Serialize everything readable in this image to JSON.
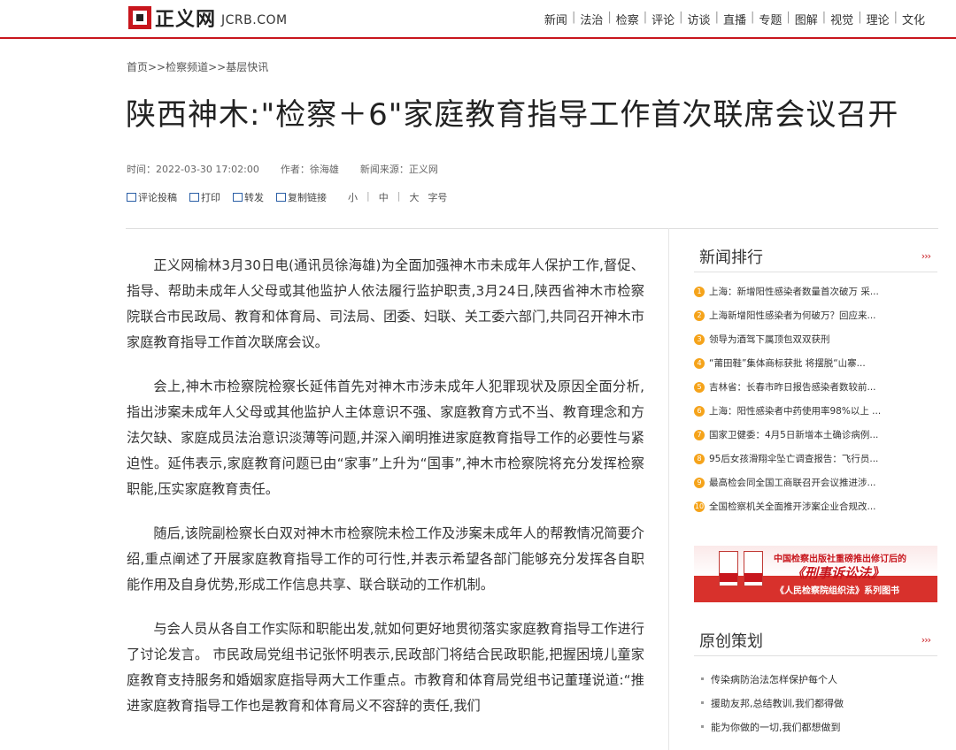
{
  "header": {
    "logo_cn": "正义网",
    "logo_en": "JCRB.COM",
    "nav": [
      "新闻",
      "法治",
      "检察",
      "评论",
      "访谈",
      "直播",
      "专题",
      "图解",
      "视觉",
      "理论",
      "文化"
    ]
  },
  "breadcrumb": "首页>>检察频道>>基层快讯",
  "article": {
    "title": "陕西神木:\"检察＋6\"家庭教育指导工作首次联席会议召开",
    "time": "时间：2022-03-30 17:02:00",
    "author": "作者：徐海雄",
    "source": "新闻来源：正义网",
    "tools": [
      "评论投稿",
      "打印",
      "转发",
      "复制链接"
    ],
    "font_sizes": [
      "小",
      "中",
      "大",
      "字号"
    ],
    "paragraphs": [
      "正义网榆林3月30日电(通讯员徐海雄)为全面加强神木市未成年人保护工作,督促、指导、帮助未成年人父母或其他监护人依法履行监护职责,3月24日,陕西省神木市检察院联合市民政局、教育和体育局、司法局、团委、妇联、关工委六部门,共同召开神木市家庭教育指导工作首次联席会议。",
      "会上,神木市检察院检察长延伟首先对神木市涉未成年人犯罪现状及原因全面分析,指出涉案未成年人父母或其他监护人主体意识不强、家庭教育方式不当、教育理念和方法欠缺、家庭成员法治意识淡薄等问题,并深入阐明推进家庭教育指导工作的必要性与紧迫性。延伟表示,家庭教育问题已由“家事”上升为“国事”,神木市检察院将充分发挥检察职能,压实家庭教育责任。",
      "随后,该院副检察长白双对神木市检察院未检工作及涉案未成年人的帮教情况简要介绍,重点阐述了开展家庭教育指导工作的可行性,并表示希望各部门能够充分发挥各自职能作用及自身优势,形成工作信息共享、联合联动的工作机制。",
      "与会人员从各自工作实际和职能出发,就如何更好地贯彻落实家庭教育指导工作进行了讨论发言。 市民政局党组书记张怀明表示,民政部门将结合民政职能,把握困境儿童家庭教育支持服务和婚姻家庭指导两大工作重点。市教育和体育局党组书记董瑾说道:“推进家庭教育指导工作也是教育和体育局义不容辞的责任,我们"
    ]
  },
  "sidebar": {
    "ranking_title": "新闻排行",
    "more": "›››",
    "ranking": [
      {
        "n": "1",
        "text": "上海：新增阳性感染者数量首次破万 采..."
      },
      {
        "n": "2",
        "text": "上海新增阳性感染者为何破万？回应来..."
      },
      {
        "n": "3",
        "text": "领导为酒驾下属顶包双双获刑"
      },
      {
        "n": "4",
        "text": "“莆田鞋”集体商标获批 将摆脱“山寨..."
      },
      {
        "n": "5",
        "text": "吉林省：长春市昨日报告感染者数较前..."
      },
      {
        "n": "6",
        "text": "上海：阳性感染者中药使用率98%以上 ..."
      },
      {
        "n": "7",
        "text": "国家卫健委：4月5日新增本土确诊病例..."
      },
      {
        "n": "8",
        "text": "95后女孩滑翔伞坠亡调查报告：飞行员..."
      },
      {
        "n": "9",
        "text": "最高检会同全国工商联召开会议推进涉..."
      },
      {
        "n": "10",
        "text": "全国检察机关全面推开涉案企业合规改..."
      }
    ],
    "banner": {
      "line1": "中国检察出版社重磅推出修订后的",
      "line2": "《刑事诉讼法》",
      "line3": "《人民检察院组织法》系列图书"
    },
    "original_title": "原创策划",
    "original": [
      "传染病防治法怎样保护每个人",
      "援助友邦,总结教训,我们都得做",
      "能为你做的一切,我们都想做到"
    ]
  },
  "colors": {
    "brand_red": "#c8161d",
    "rank_orange": "#f5a31a"
  }
}
